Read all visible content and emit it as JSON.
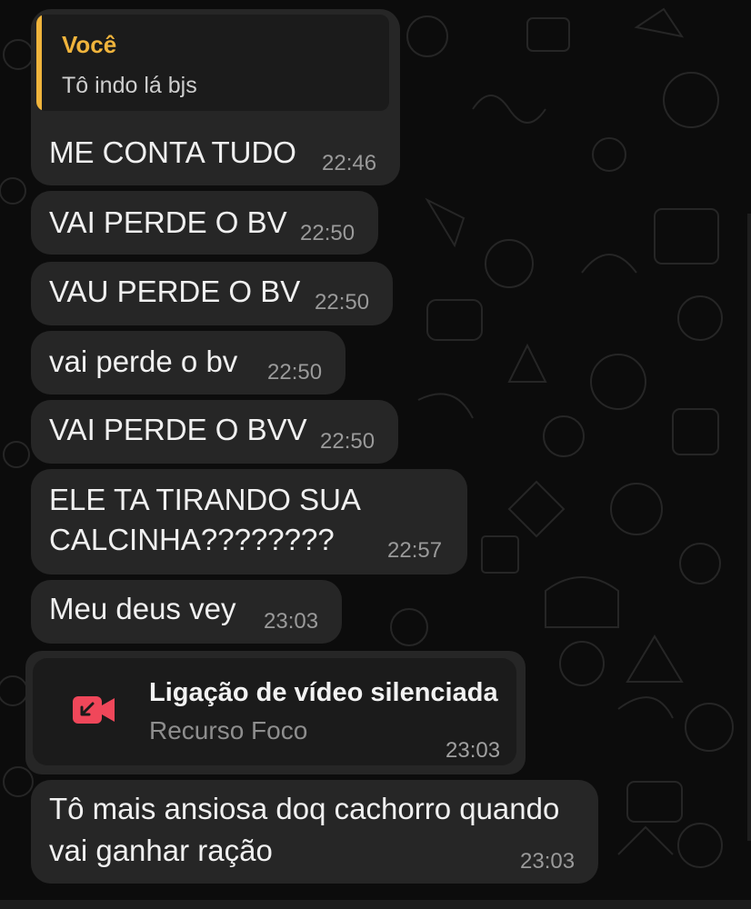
{
  "quote": {
    "author": "Você",
    "text": "Tô indo lá bjs"
  },
  "messages": [
    {
      "text": "ME CONTA TUDO",
      "time": "22:46"
    },
    {
      "text": "VAI PERDE O BV",
      "time": "22:50"
    },
    {
      "text": "VAU PERDE O BV",
      "time": "22:50"
    },
    {
      "text": "vai perde o bv",
      "time": "22:50"
    },
    {
      "text": "VAI PERDE O BVV",
      "time": "22:50"
    },
    {
      "line1": "ELE TA TIRANDO SUA",
      "line2": "CALCINHA????????",
      "time": "22:57"
    },
    {
      "text": "Meu deus vey",
      "time": "23:03"
    },
    {
      "line1": "Tô mais ansiosa doq cachorro quando",
      "line2": "vai ganhar ração",
      "time": "23:03"
    }
  ],
  "call": {
    "title": "Ligação de vídeo silenciada",
    "subtitle": "Recurso Foco",
    "time": "23:03",
    "icon": "muted-video-call-icon"
  },
  "colors": {
    "background": "#0c0c0c",
    "bubble": "#262626",
    "quote_accent": "#f0b43c",
    "call_icon": "#f0475a"
  }
}
